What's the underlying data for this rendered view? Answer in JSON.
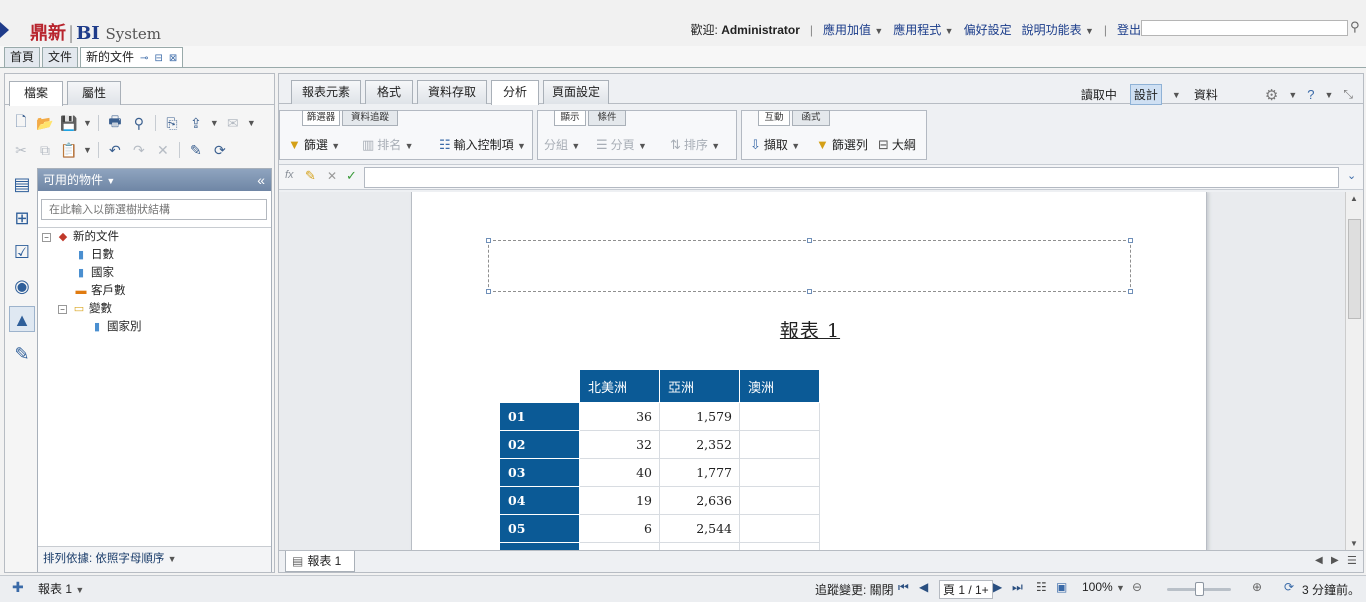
{
  "brand": {
    "part1": "鼎新",
    "sep": "|",
    "part2": "BI",
    "part3": "System"
  },
  "topnav": {
    "welcome_label": "歡迎:",
    "user": "Administrator",
    "items": [
      "應用加值",
      "應用程式",
      "偏好設定",
      "說明功能表",
      "登出"
    ]
  },
  "doc_tabs": {
    "home": "首頁",
    "docs": "文件",
    "current": "新的文件"
  },
  "left_tabs": {
    "file": "檔案",
    "props": "屬性"
  },
  "objects": {
    "header": "可用的物件",
    "search_placeholder": "在此輸入以篩選樹狀結構",
    "tree": {
      "root": "新的文件",
      "days": "日數",
      "country": "國家",
      "customers": "客戶數",
      "variables": "變數",
      "country_var": "國家別"
    },
    "sort_label": "排列依據: 依照字母順序"
  },
  "main_tabs": [
    "報表元素",
    "格式",
    "資料存取",
    "分析",
    "頁面設定"
  ],
  "modes": {
    "reading": "讀取中",
    "design": "設計",
    "data": "資料"
  },
  "groups": {
    "g1_tabs": [
      "篩選器",
      "資料追蹤"
    ],
    "g1_buttons": {
      "filter": "篩選",
      "rank": "排名",
      "input_ctrl": "輸入控制項"
    },
    "g2_tabs": [
      "顯示",
      "條件"
    ],
    "g2_buttons": {
      "group": "分組",
      "paging": "分頁",
      "sort": "排序"
    },
    "g3_tabs": [
      "互動",
      "函式"
    ],
    "g3_buttons": {
      "drill": "擷取",
      "filter_bar": "篩選列",
      "outline": "大綱"
    }
  },
  "report": {
    "title": "報表 1",
    "columns": [
      "北美洲",
      "亞洲",
      "澳洲"
    ],
    "rows": [
      {
        "label": "01",
        "v": [
          "36",
          "1,579",
          ""
        ]
      },
      {
        "label": "02",
        "v": [
          "32",
          "2,352",
          ""
        ]
      },
      {
        "label": "03",
        "v": [
          "40",
          "1,777",
          ""
        ]
      },
      {
        "label": "04",
        "v": [
          "19",
          "2,636",
          ""
        ]
      },
      {
        "label": "05",
        "v": [
          "6",
          "2,544",
          ""
        ]
      }
    ]
  },
  "report_tab": "報表 1",
  "status": {
    "report_selector": "報表 1",
    "track_changes": "追蹤變更: 關閉",
    "page": "頁 1 / 1+",
    "zoom": "100%",
    "refreshed": "3 分鐘前。"
  }
}
